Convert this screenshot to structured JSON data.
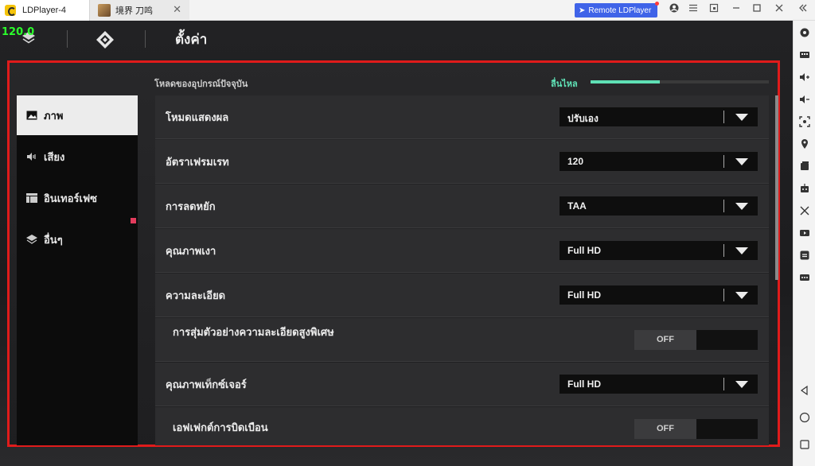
{
  "titlebar": {
    "tab1_label": "LDPlayer-4",
    "tab2_label": "境界 刀鸣",
    "tab2_close": "✕",
    "remote_label": "Remote LDPlayer",
    "icons": [
      "account-icon",
      "menu-icon",
      "restore-window-icon",
      "minimize-icon",
      "maximize-icon",
      "close-icon",
      "collapse-sidebar-icon"
    ]
  },
  "game": {
    "fps": "120.0",
    "page_title": "ตั้งค่า"
  },
  "menu": {
    "items": [
      {
        "label": "ภาพ",
        "icon": "image-icon",
        "active": true
      },
      {
        "label": "เสียง",
        "icon": "speaker-icon",
        "active": false
      },
      {
        "label": "อินเทอร์เฟซ",
        "icon": "layout-icon",
        "active": false
      },
      {
        "label": "อื่นๆ",
        "icon": "layers-icon",
        "active": false
      }
    ]
  },
  "header": {
    "load_label": "โหลดของอุปกรณ์ปัจจุบัน",
    "smooth_label": "ลื่นไหล",
    "load_level": 0.39,
    "accent": "#5fe0b5"
  },
  "settings": [
    {
      "label": "โหมดแสดงผล",
      "type": "dropdown",
      "value": "ปรับเอง"
    },
    {
      "label": "อัตราเฟรมเรท",
      "type": "dropdown",
      "value": "120"
    },
    {
      "label": "การลดหยัก",
      "type": "dropdown",
      "value": "TAA"
    },
    {
      "label": "คุณภาพเงา",
      "type": "dropdown",
      "value": "Full HD"
    },
    {
      "label": "ความละเอียด",
      "type": "dropdown",
      "value": "Full HD"
    },
    {
      "label": "การสุ่มตัวอย่างความละเอียดสูงพิเศษ",
      "type": "toggle",
      "value": "OFF"
    },
    {
      "label": "คุณภาพเท็กซ์เจอร์",
      "type": "dropdown",
      "value": "Full HD"
    },
    {
      "label": "เอฟเฟกต์การบิดเบือน",
      "type": "toggle",
      "value": "OFF"
    }
  ],
  "colors": {
    "highlight_border": "#e01b1b",
    "remote_button": "#3f63e8",
    "fps_text": "#2bff2b"
  }
}
